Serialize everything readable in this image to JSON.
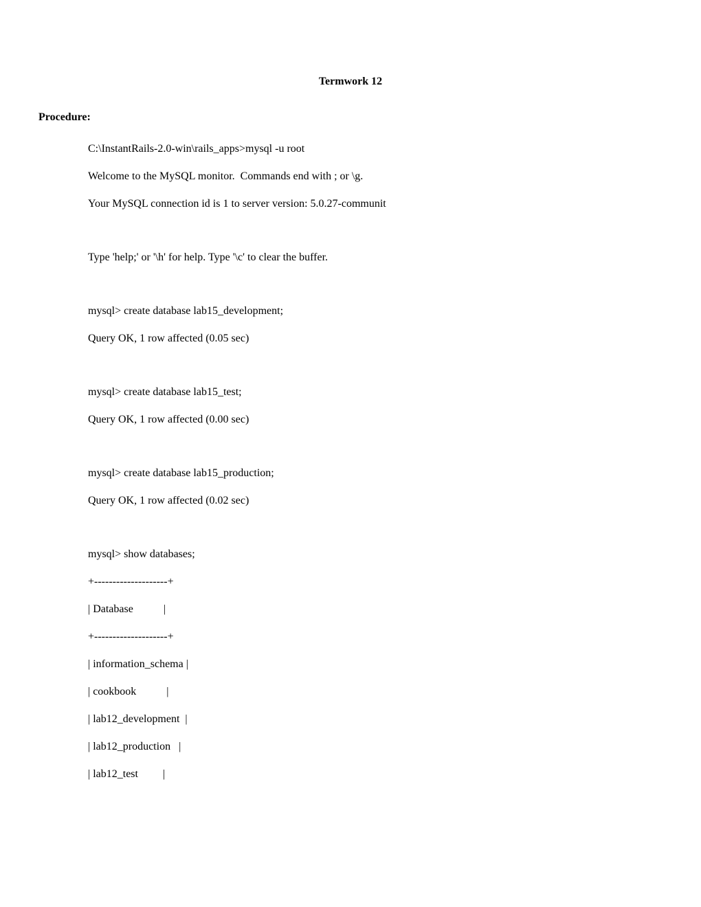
{
  "title": "Termwork 12",
  "procedure_label": "Procedure:",
  "lines": [
    "C:\\InstantRails-2.0-win\\rails_apps>mysql -u root",
    "Welcome to the MySQL monitor.  Commands end with ; or \\g.",
    "Your MySQL connection id is 1 to server version: 5.0.27-communit",
    "",
    "Type 'help;' or '\\h' for help. Type '\\c' to clear the buffer.",
    "",
    "mysql> create database lab15_development;",
    "Query OK, 1 row affected (0.05 sec)",
    "",
    "mysql> create database lab15_test;",
    "Query OK, 1 row affected (0.00 sec)",
    "",
    "mysql> create database lab15_production;",
    "Query OK, 1 row affected (0.02 sec)",
    "",
    "mysql> show databases;",
    "+--------------------+",
    "| Database           |",
    "+--------------------+",
    "| information_schema |",
    "| cookbook           |",
    "| lab12_development  |",
    "| lab12_production   |",
    "| lab12_test         |"
  ]
}
